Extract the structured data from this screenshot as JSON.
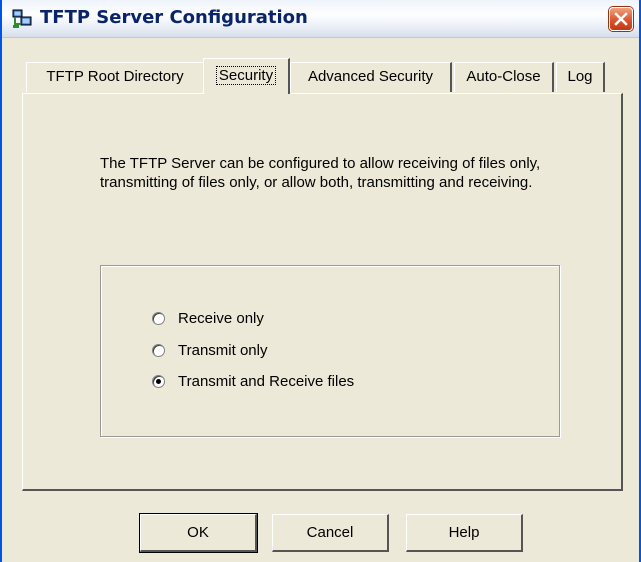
{
  "window": {
    "title": "TFTP Server Configuration"
  },
  "icons": {
    "app": "network-computers-icon",
    "close": "close-icon"
  },
  "tabs": [
    {
      "label": "TFTP Root Directory",
      "active": false
    },
    {
      "label": "Security",
      "active": true
    },
    {
      "label": "Advanced Security",
      "active": false
    },
    {
      "label": "Auto-Close",
      "active": false
    },
    {
      "label": "Log",
      "active": false
    }
  ],
  "security": {
    "description": "The TFTP Server can be configured to allow receiving of files only, transmitting of files only, or allow both, transmitting and receiving.",
    "options": [
      {
        "label": "Receive only",
        "checked": false
      },
      {
        "label": "Transmit only",
        "checked": false
      },
      {
        "label": "Transmit and Receive files",
        "checked": true
      }
    ]
  },
  "buttons": {
    "ok": "OK",
    "cancel": "Cancel",
    "help": "Help"
  }
}
